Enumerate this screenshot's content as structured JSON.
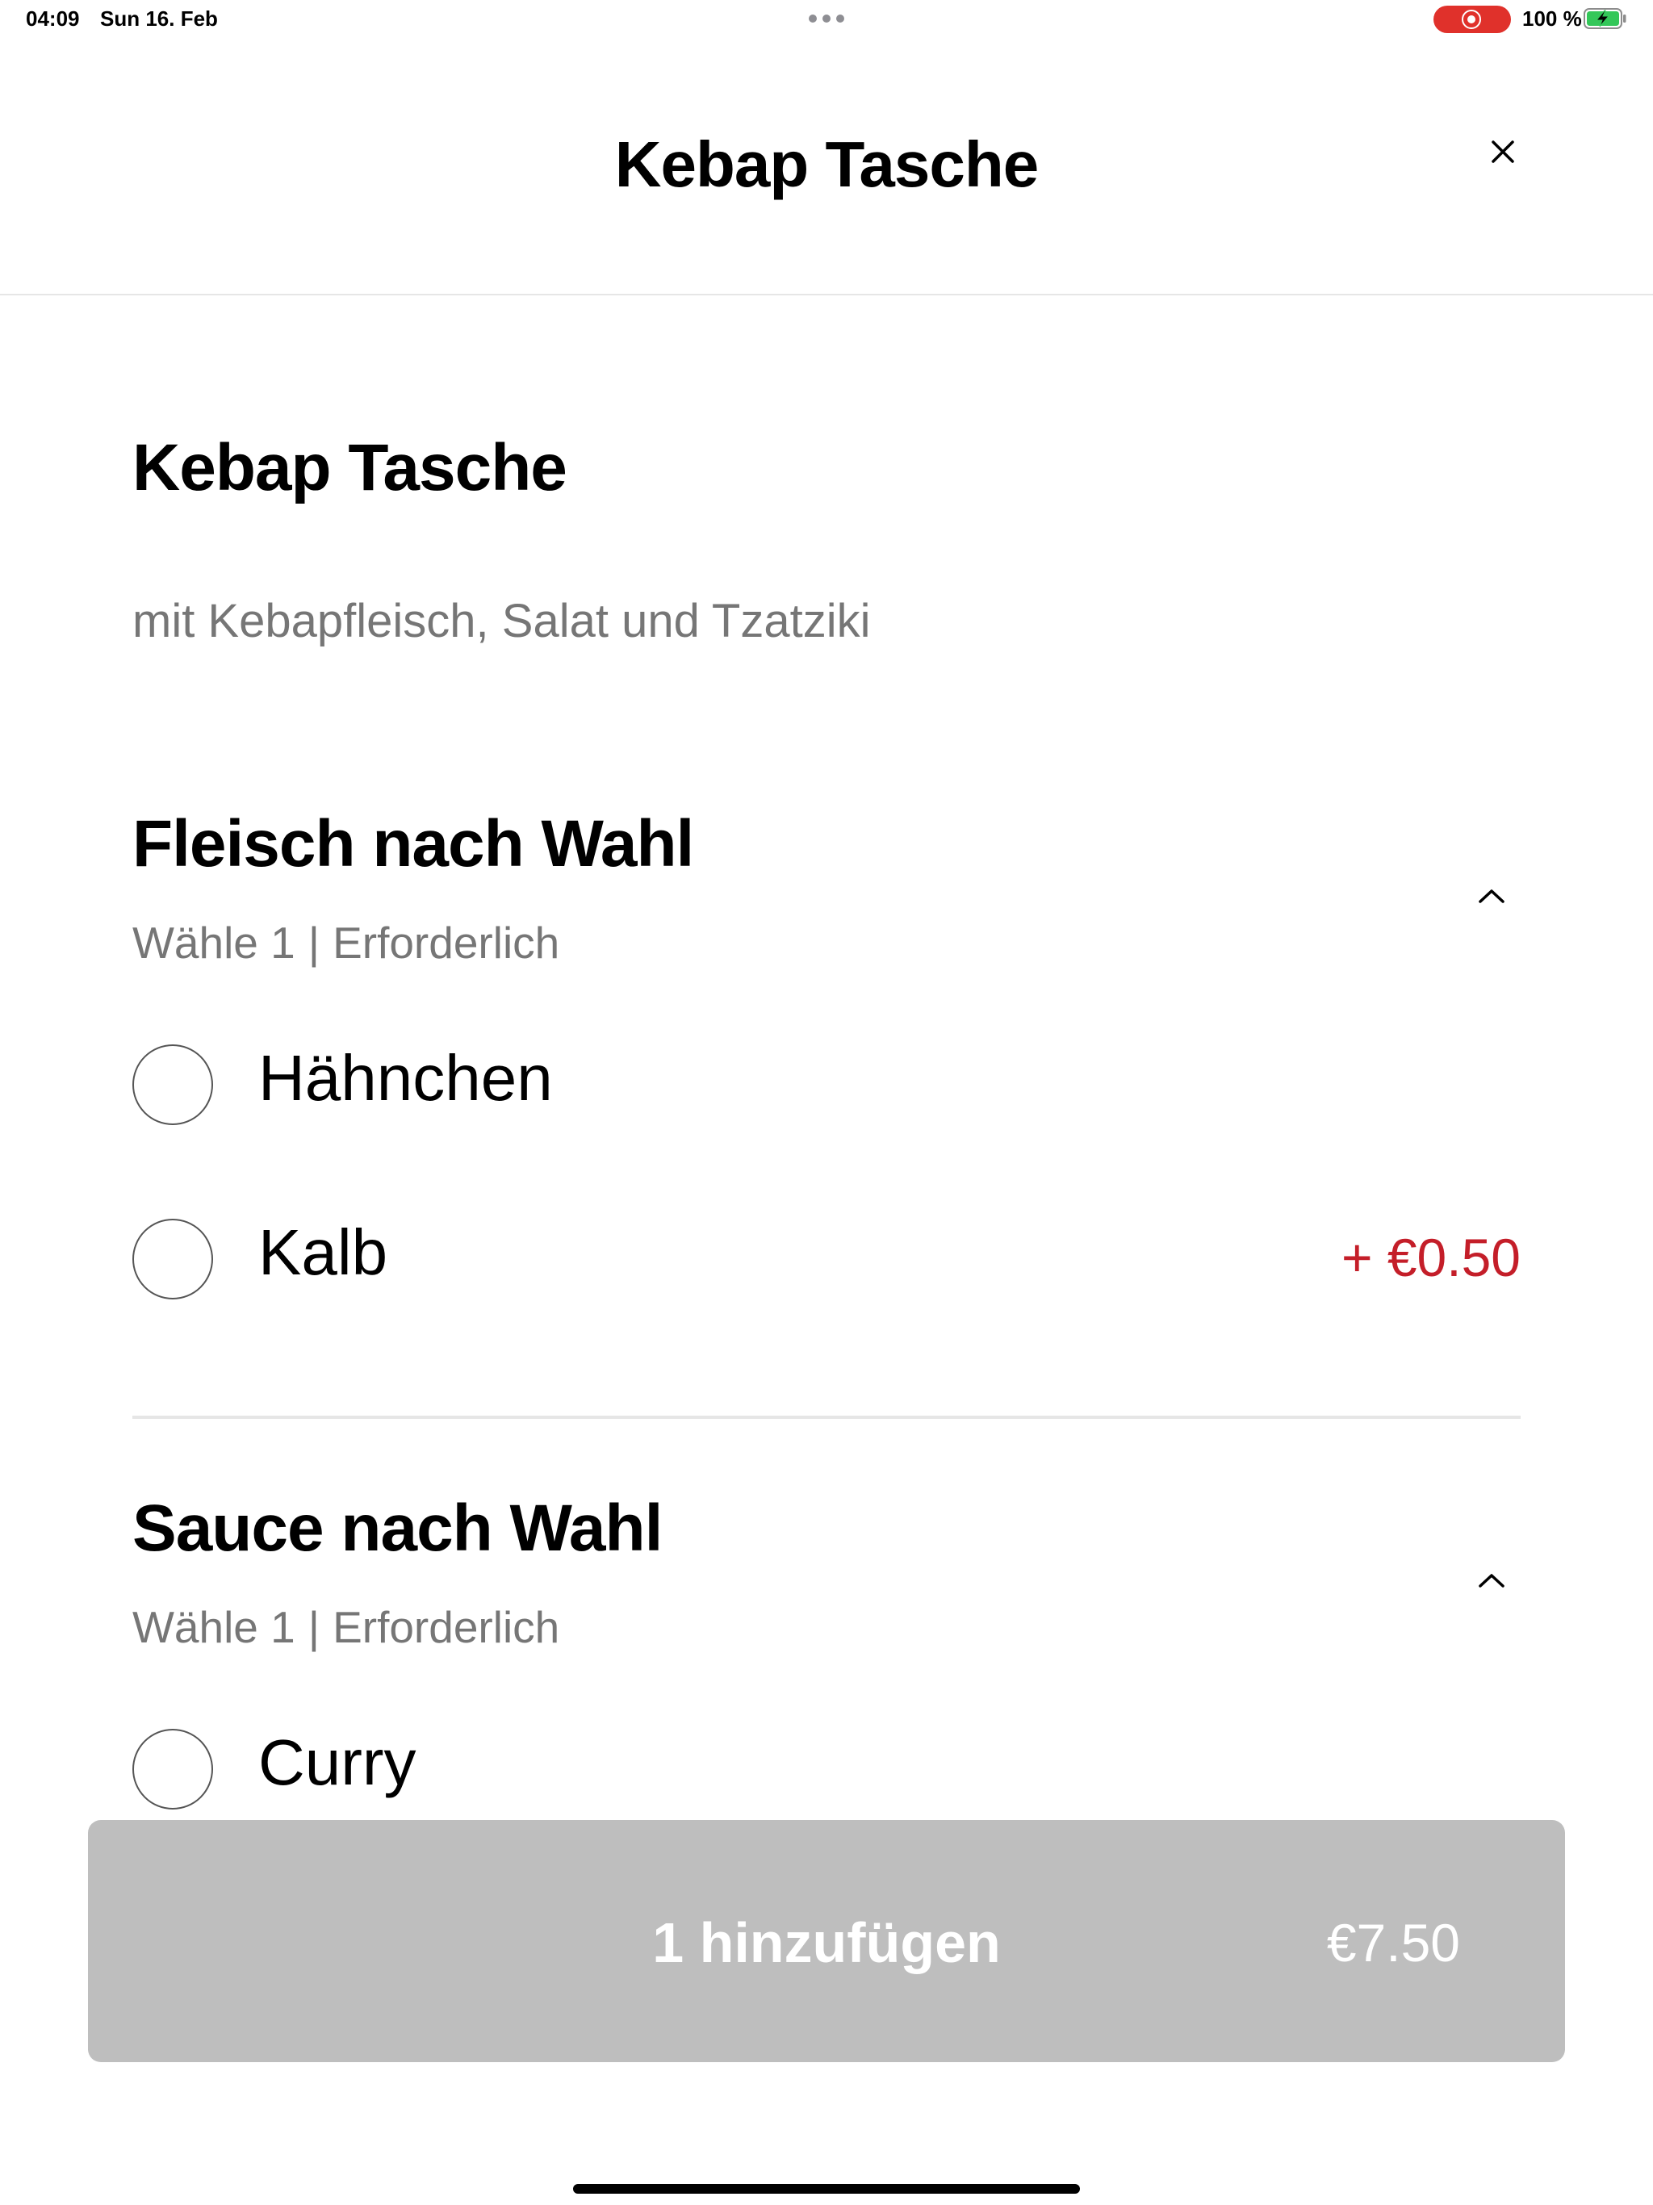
{
  "status_bar": {
    "time": "04:09",
    "date": "Sun 16. Feb",
    "battery": "100 %",
    "recording_color": "#e0312b",
    "battery_icon": "battery-charging-icon"
  },
  "header": {
    "title": "Kebap Tasche",
    "close_icon": "close-icon"
  },
  "item": {
    "title": "Kebap Tasche",
    "description": "mit Kebapfleisch, Salat und Tzatziki"
  },
  "groups": [
    {
      "title": "Fleisch nach Wahl",
      "choose": "Wähle 1",
      "separator": "|",
      "required": "Erforderlich",
      "options": [
        {
          "label": "Hähnchen",
          "price": ""
        },
        {
          "label": "Kalb",
          "price": "+ €0.50"
        }
      ]
    },
    {
      "title": "Sauce nach Wahl",
      "choose": "Wähle 1",
      "separator": "|",
      "required": "Erforderlich",
      "options": [
        {
          "label": "Curry",
          "price": ""
        }
      ]
    }
  ],
  "add_bar": {
    "label": "1 hinzufügen",
    "price": "€7.50",
    "background": "#bebebe"
  },
  "colors": {
    "accent_price": "#c41e29",
    "secondary_text": "#767676"
  }
}
